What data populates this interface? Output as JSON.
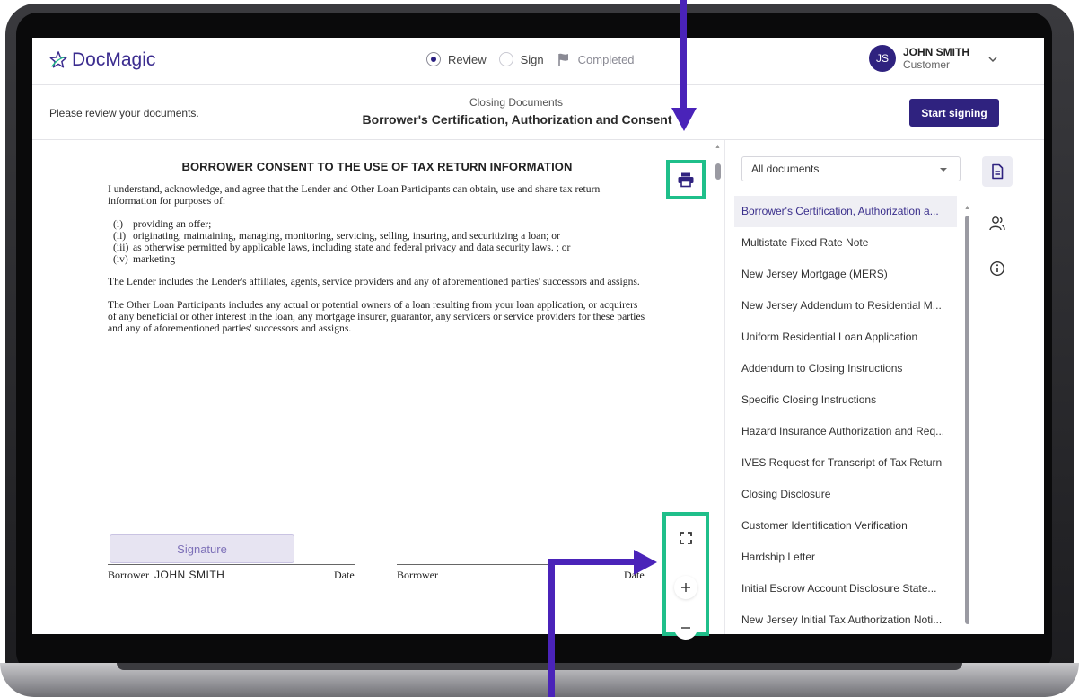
{
  "app": {
    "brand": "DocMagic",
    "brand_color": "#3b2c8f",
    "accent_color": "#2f227f",
    "highlight_color": "#1fbf8a"
  },
  "steps": [
    {
      "label": "Review",
      "state": "current"
    },
    {
      "label": "Sign",
      "state": "pending"
    },
    {
      "label": "Completed",
      "state": "pending"
    }
  ],
  "user": {
    "initials": "JS",
    "name": "JOHN SMITH",
    "role": "Customer"
  },
  "subheader": {
    "message": "Please review your documents.",
    "category": "Closing Documents",
    "title": "Borrower's Certification, Authorization and Consent",
    "start_label": "Start signing"
  },
  "document": {
    "heading": "BORROWER CONSENT TO THE USE OF TAX RETURN INFORMATION",
    "intro": "I understand, acknowledge, and agree that the Lender and Other Loan Participants can obtain, use and share tax return information for purposes of:",
    "items": [
      {
        "num": "(i)",
        "text": "providing an offer;"
      },
      {
        "num": "(ii)",
        "text": "originating, maintaining, managing, monitoring, servicing, selling, insuring, and securitizing a loan; or"
      },
      {
        "num": "(iii)",
        "text": "as otherwise permitted by applicable laws, including state and federal privacy and data security laws. ; or"
      },
      {
        "num": "(iv)",
        "text": "marketing"
      }
    ],
    "para2": "The Lender includes the Lender's affiliates, agents, service providers and any of aforementioned parties' successors and assigns.",
    "para3": "The Other Loan Participants includes any actual or potential owners of a loan resulting from your loan application, or acquirers of any beneficial or other interest in the loan, any mortgage insurer, guarantor, any servicers or service providers for these parties and any of aforementioned  parties' successors and assigns.",
    "signature_button": "Signature",
    "borrower_label": "Borrower",
    "borrower_name": "JOHN SMITH",
    "date_label": "Date",
    "borrower2_label": "Borrower",
    "date2_label": "Date"
  },
  "sidebar": {
    "filter": "All documents",
    "documents": [
      "Borrower's Certification, Authorization a...",
      "Multistate Fixed Rate Note",
      "New Jersey Mortgage (MERS)",
      "New Jersey Addendum to Residential M...",
      "Uniform Residential Loan Application",
      "Addendum to Closing Instructions",
      "Specific Closing Instructions",
      "Hazard Insurance Authorization and Req...",
      "IVES Request for Transcript of Tax Return",
      "Closing Disclosure",
      "Customer Identification Verification",
      "Hardship Letter",
      "Initial Escrow Account Disclosure State...",
      "New Jersey Initial Tax Authorization Noti..."
    ]
  },
  "icons": {
    "print": "print-icon",
    "fullscreen": "fullscreen-icon",
    "zoom_in": "zoom-in-icon",
    "zoom_out": "zoom-out-icon",
    "documents": "document-icon",
    "participants": "people-icon",
    "info": "info-icon"
  }
}
